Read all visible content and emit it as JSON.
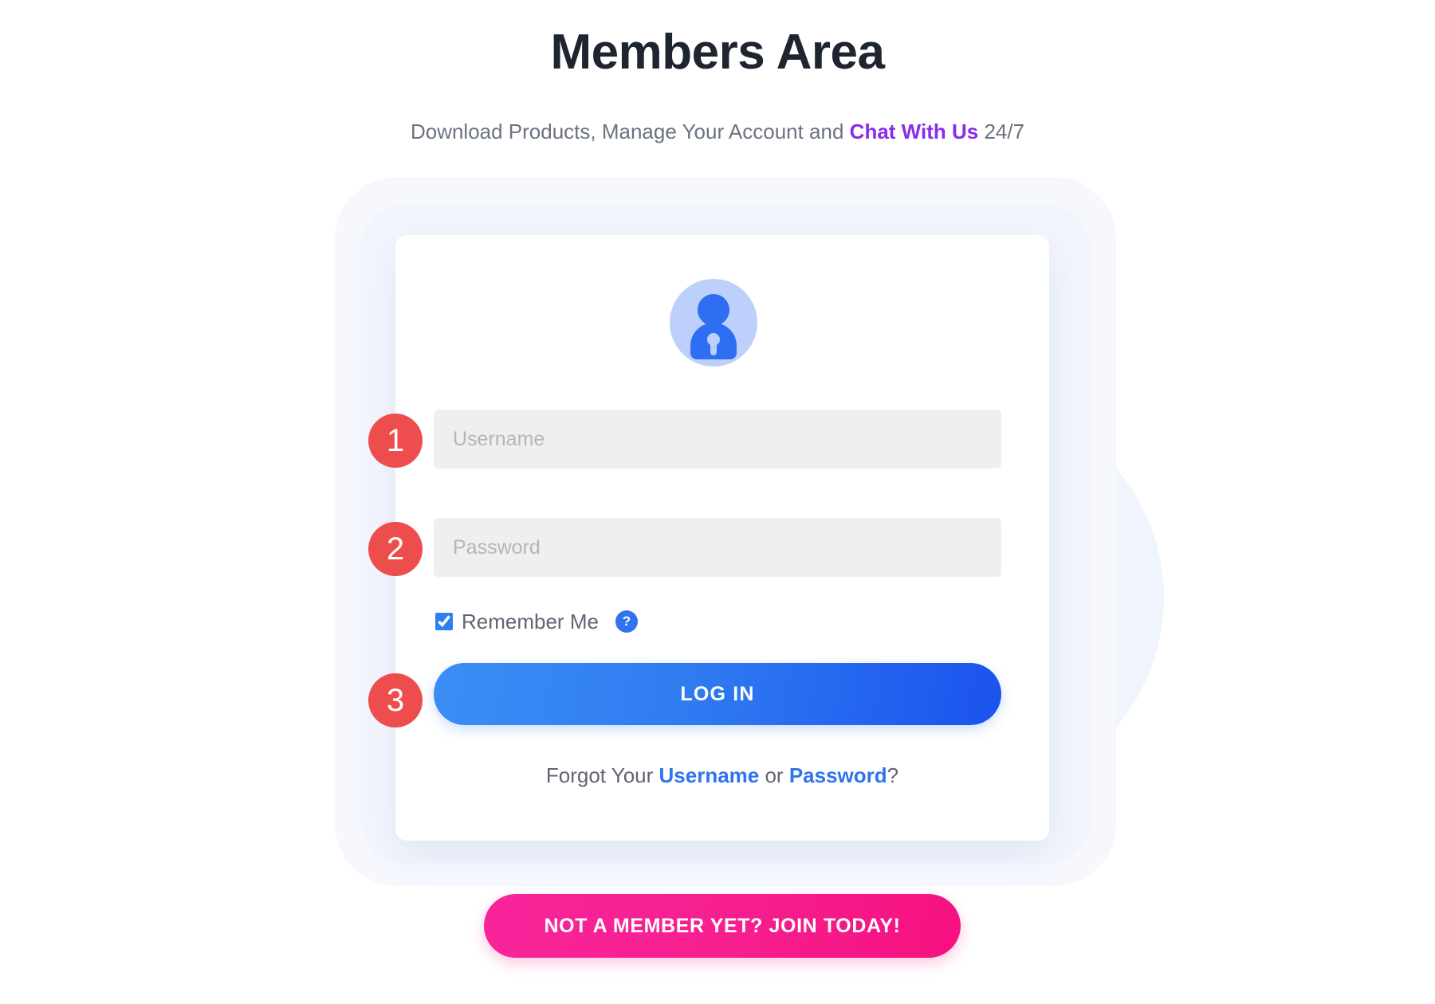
{
  "header": {
    "title": "Members Area",
    "subtitle_prefix": "Download Products, Manage Your Account and ",
    "subtitle_link": "Chat With Us",
    "subtitle_suffix": " 24/7"
  },
  "avatar": {
    "icon_name": "user-lock-avatar-icon"
  },
  "steps": {
    "one": "1",
    "two": "2",
    "three": "3"
  },
  "form": {
    "username_placeholder": "Username",
    "username_value": "",
    "password_placeholder": "Password",
    "password_value": "",
    "remember_label": "Remember Me",
    "remember_checked": true,
    "help_icon_label": "?",
    "login_label": "LOG IN"
  },
  "forgot": {
    "prefix": "Forgot Your ",
    "username_link": "Username",
    "separator": " or ",
    "password_link": "Password",
    "suffix": "?"
  },
  "cta": {
    "join_label": "NOT A MEMBER YET? JOIN TODAY!"
  },
  "colors": {
    "title": "#1e2430",
    "body_text": "#5f6571",
    "purple_link": "#8b2bea",
    "blue_link": "#2f74ed",
    "step_badge_red": "#ee4d4d",
    "login_blue_start": "#3b8ef5",
    "login_blue_end": "#1b52ee",
    "join_pink_start": "#f8259b",
    "join_pink_end": "#f5117f",
    "avatar_bg": "#bcd0fb",
    "avatar_fg": "#2f6ef2",
    "field_bg": "#efeff0",
    "card_bg": "#ffffff",
    "page_bg": "#ffffff",
    "blob_blue": "#eff4fd"
  }
}
